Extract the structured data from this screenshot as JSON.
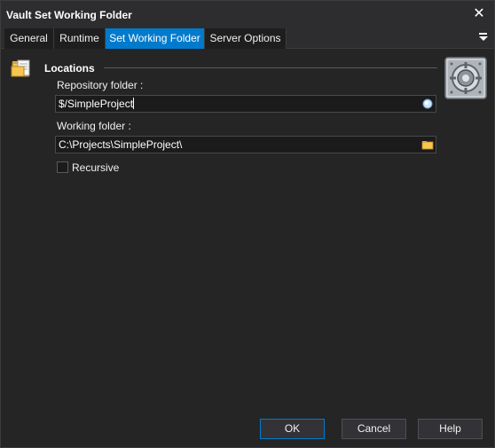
{
  "window": {
    "title": "Vault Set Working Folder"
  },
  "tabs": [
    {
      "label": "General"
    },
    {
      "label": "Runtime"
    },
    {
      "label": "Set Working Folder"
    },
    {
      "label": "Server Options"
    }
  ],
  "section": {
    "title": "Locations"
  },
  "fields": {
    "repository": {
      "label": "Repository folder :",
      "value": "$/SimpleProject"
    },
    "working": {
      "label": "Working folder :",
      "value": "C:\\Projects\\SimpleProject\\"
    }
  },
  "recursive": {
    "label": "Recursive",
    "checked": false
  },
  "buttons": {
    "ok": "OK",
    "cancel": "Cancel",
    "help": "Help"
  },
  "colors": {
    "accent": "#007acc",
    "background": "#252526"
  },
  "icons": {
    "close": "close-icon",
    "menu": "tab-menu-icon",
    "section": "folder-icon",
    "action": "vault-icon",
    "repository_browse": "repository-browse-icon",
    "folder_browse": "folder-browse-icon"
  }
}
